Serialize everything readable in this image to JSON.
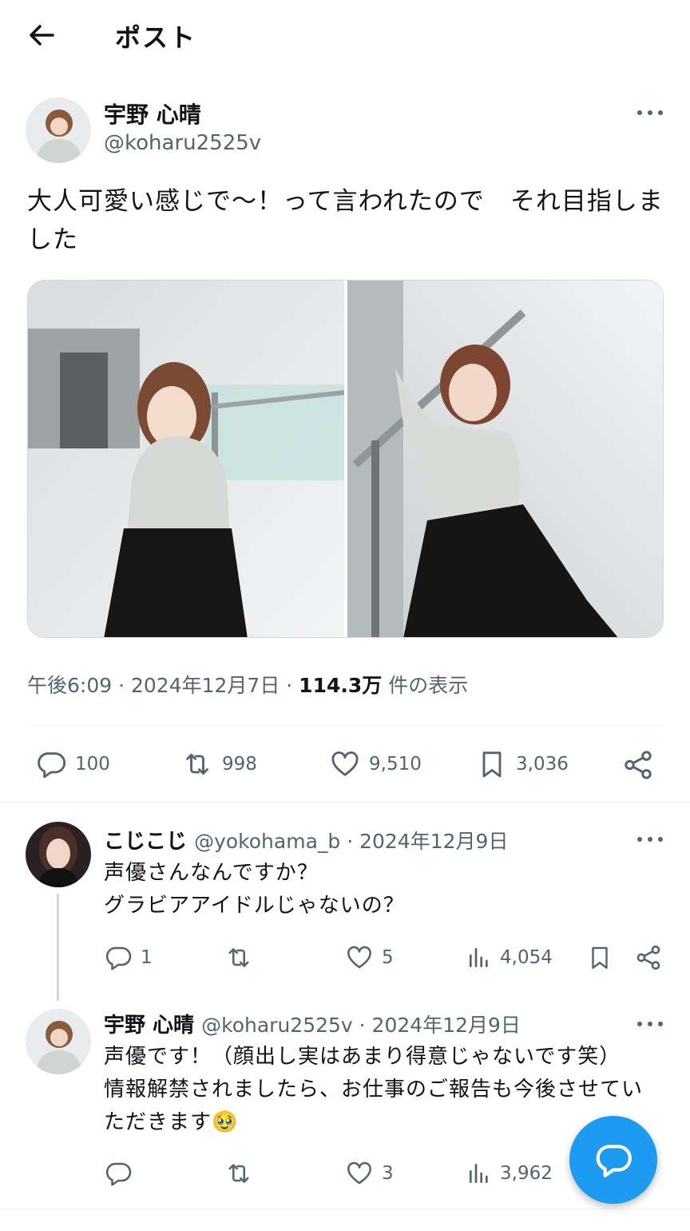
{
  "header": {
    "title": "ポスト"
  },
  "post": {
    "author_name": "宇野 心晴",
    "author_handle": "@koharu2525v",
    "text": "大人可愛い感じで〜！って言われたので　それ目指しました",
    "time": "午後6:09 · 2024年12月7日 · ",
    "views": "114.3万",
    "views_label": " 件の表示",
    "replies": "100",
    "reposts": "998",
    "likes": "9,510",
    "bookmarks": "3,036"
  },
  "replies": [
    {
      "name": "こじこじ",
      "handle": "@yokohama_b · 2024年12月9日",
      "text": "声優さんなんですか？\nグラビアアイドルじゃないの？",
      "replies": "1",
      "reposts": "",
      "likes": "5",
      "views": "4,054"
    },
    {
      "name": "宇野 心晴",
      "handle": "@koharu2525v · 2024年12月9日",
      "text": "声優です！（顔出し実はあまり得意じゃないです笑）\n情報解禁されましたら、お仕事のご報告も今後させていただきます🥹",
      "replies": "",
      "reposts": "",
      "likes": "3",
      "views": "3,962"
    }
  ],
  "icons": {
    "back": "arrow-left-icon",
    "more": "more-icon",
    "reply": "reply-icon",
    "repost": "repost-icon",
    "like": "heart-icon",
    "bookmark": "bookmark-icon",
    "share": "share-icon",
    "views": "views-icon",
    "compose": "compose-reply-icon"
  },
  "colors": {
    "accent": "#1d9bf0",
    "secondary_text": "#536471",
    "text": "#0f1419"
  }
}
